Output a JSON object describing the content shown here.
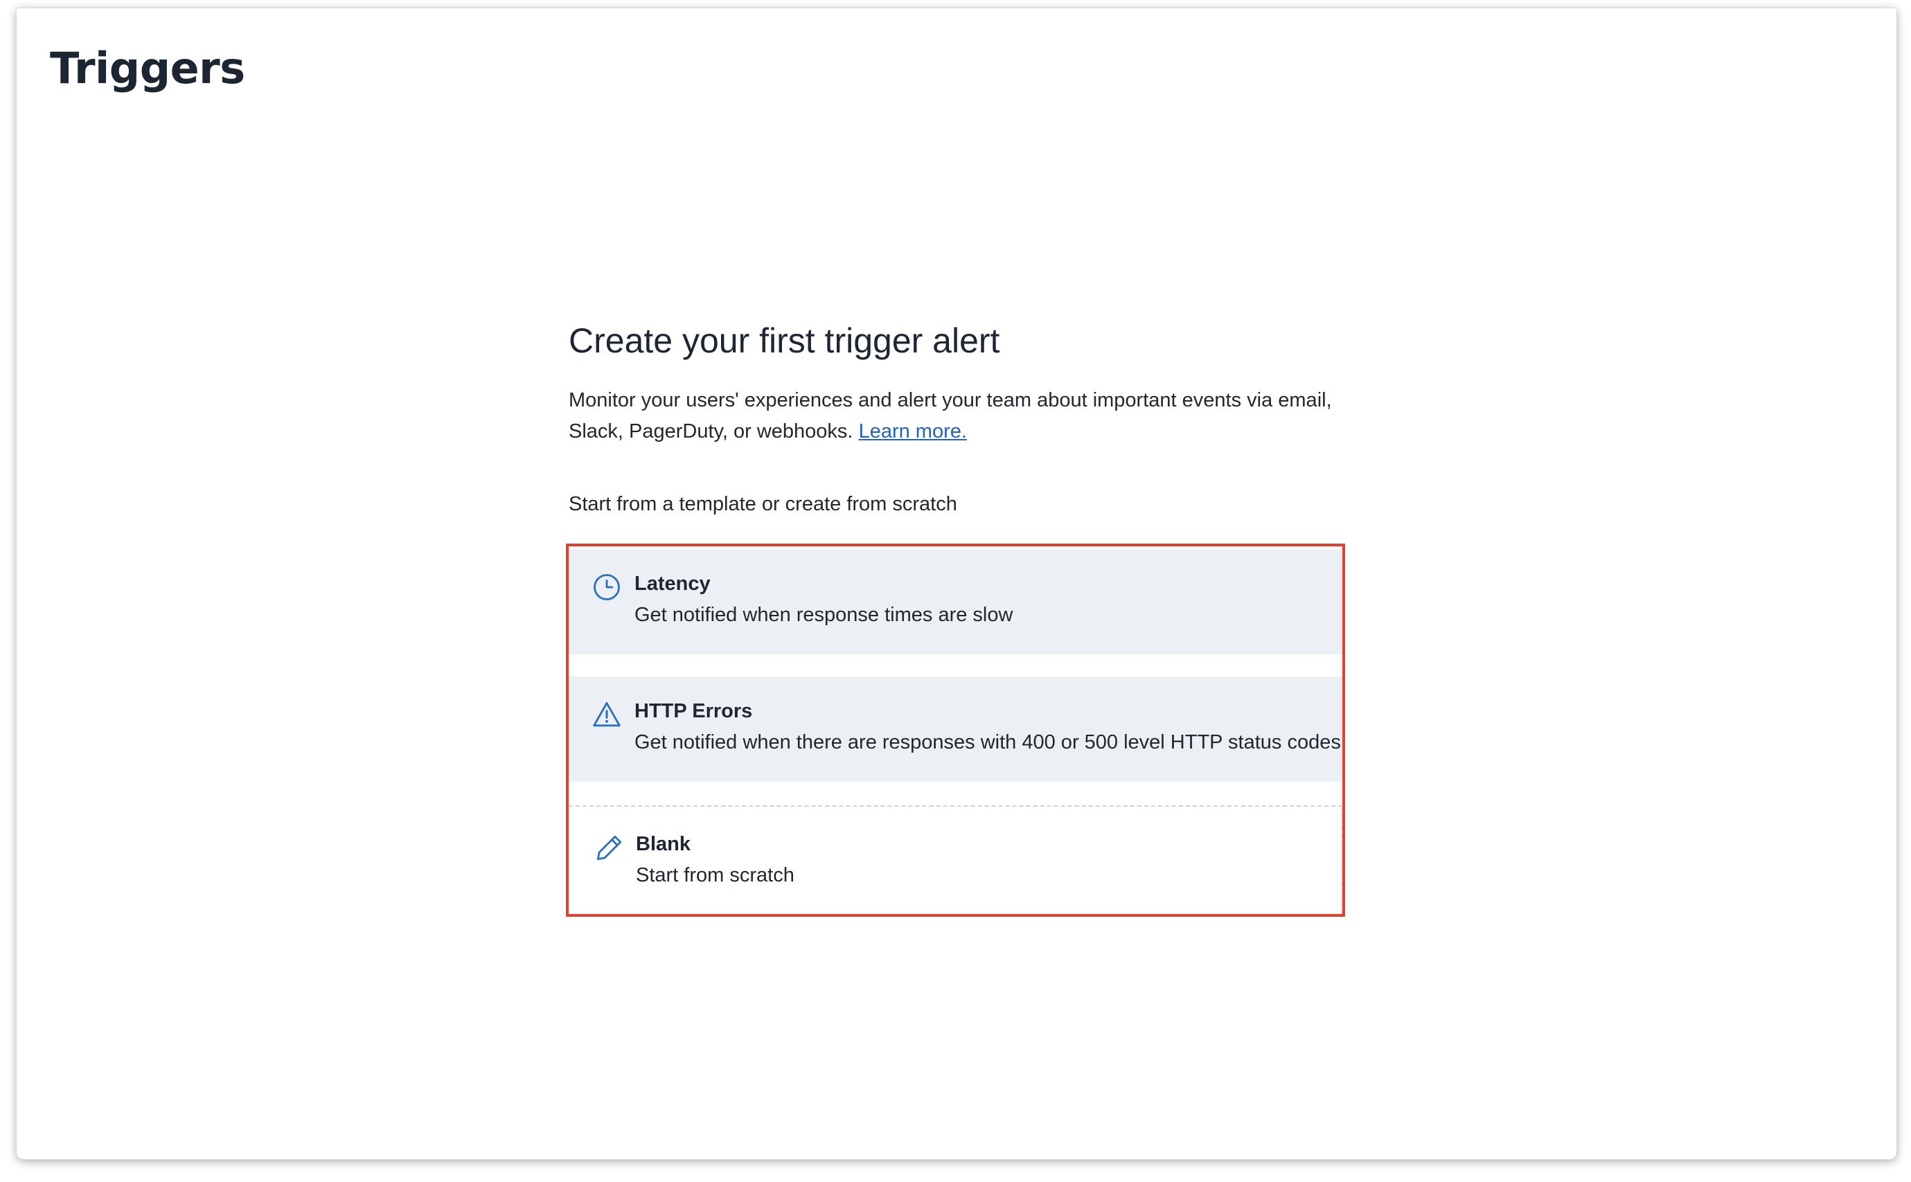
{
  "page": {
    "title": "Triggers"
  },
  "empty_state": {
    "heading": "Create your first trigger alert",
    "description": "Monitor your users' experiences and alert your team about important events via email, Slack, PagerDuty, or webhooks.",
    "learn_more_label": "Learn more.",
    "template_intro": "Start from a template or create from scratch"
  },
  "options": [
    {
      "title": "Latency",
      "description": "Get notified when response times are slow",
      "icon": "clock-icon"
    },
    {
      "title": "HTTP Errors",
      "description": "Get notified when there are responses with 400 or 500 level HTTP status codes",
      "icon": "warning-triangle-icon"
    },
    {
      "title": "Blank",
      "description": "Start from scratch",
      "icon": "pencil-icon"
    }
  ],
  "colors": {
    "highlight_border": "#e3412f",
    "link": "#1f63c4",
    "icon": "#2a6fc0",
    "option_background": "#eceff3"
  }
}
